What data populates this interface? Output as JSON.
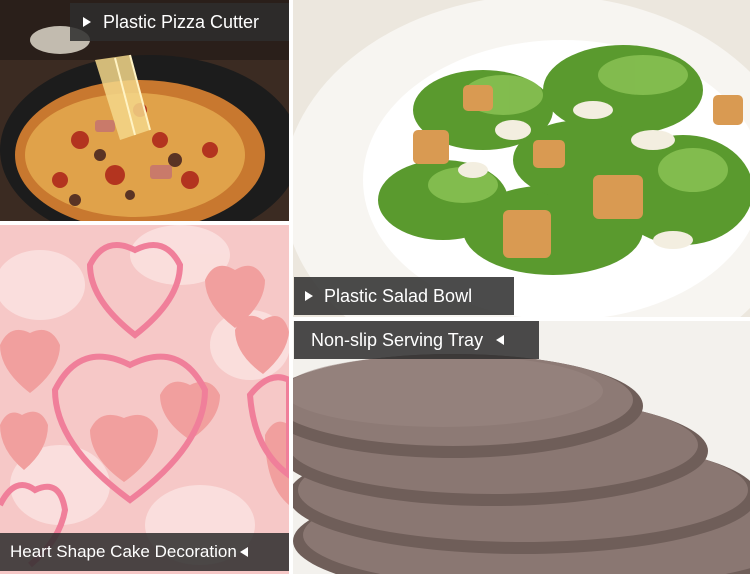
{
  "tiles": {
    "pizza": {
      "caption": "Plastic Pizza Cutter",
      "arrow": "right"
    },
    "salad": {
      "caption": "Plastic Salad Bowl",
      "arrow": "right"
    },
    "tray": {
      "caption": "Non-slip Serving Tray",
      "arrow": "left"
    },
    "hearts": {
      "caption": "Heart Shape Cake Decoration",
      "arrow": "left"
    }
  },
  "colors": {
    "caption_bg": "#2d2d2d",
    "caption_text": "#ffffff",
    "tray_brown": "#7a6862",
    "heart_pink": "#f07f9a",
    "lettuce_green": "#5a9a2e"
  }
}
